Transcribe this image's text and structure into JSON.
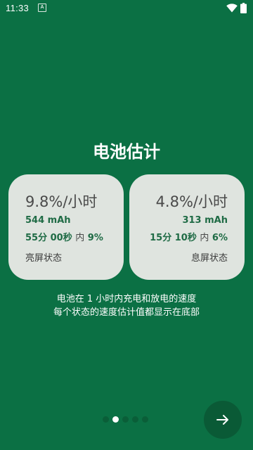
{
  "status_bar": {
    "time": "11:33",
    "notification_icon": "A",
    "wifi_icon": "wifi-icon",
    "battery_icon": "battery-icon"
  },
  "title": "电池估计",
  "cards": {
    "screen_on": {
      "rate": "9.8%/小时",
      "mah": "544 mAh",
      "duration": "55分 00秒",
      "within": "内",
      "percent": "9%",
      "state": "亮屏状态"
    },
    "screen_off": {
      "rate": "4.8%/小时",
      "mah": "313 mAh",
      "duration": "15分 10秒",
      "within": "内",
      "percent": "6%",
      "state": "息屏状态"
    }
  },
  "description": {
    "line1": "电池在 1 小时内充电和放电的速度",
    "line2": "每个状态的速度估计值都显示在底部"
  },
  "pager": {
    "total": 5,
    "active_index": 1
  },
  "next_button": {
    "icon": "arrow-right-icon"
  },
  "colors": {
    "background": "#0b7044",
    "card": "#dfe4df",
    "accent_text": "#1f6b45",
    "button": "#0a5a36"
  }
}
